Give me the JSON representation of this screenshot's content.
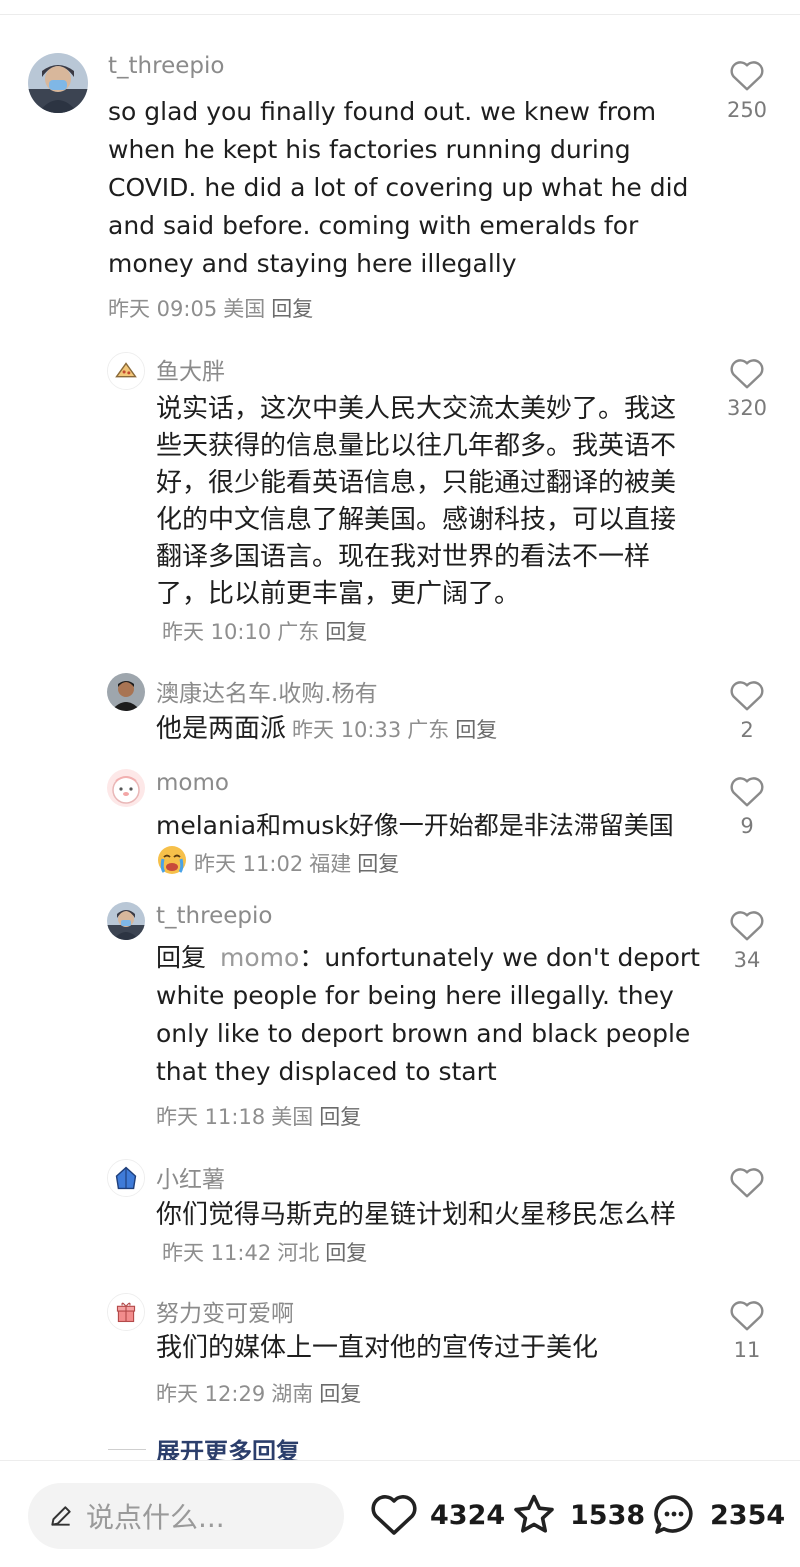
{
  "comments": [
    {
      "username": "t_threepio",
      "text": "so glad you finally found out. we knew from when he kept his factories running during COVID. he did a lot of covering up what he did and said before. coming with emeralds for money and staying here illegally",
      "time": "昨天 09:05",
      "location": "美国",
      "reply_label": "回复",
      "likes": "250"
    },
    {
      "username": "鱼大胖",
      "text": "说实话，这次中美人民大交流太美妙了。我这些天获得的信息量比以往几年都多。我英语不好，很少能看英语信息，只能通过翻译的被美化的中文信息了解美国。感谢科技，可以直接翻译多国语言。现在我对世界的看法不一样了，比以前更丰富，更广阔了。",
      "time": "昨天 10:10",
      "location": "广东",
      "reply_label": "回复",
      "likes": "320"
    },
    {
      "username": "澳康达名车.收购.杨有",
      "text": "他是两面派",
      "time": "昨天 10:33",
      "location": "广东",
      "reply_label": "回复",
      "likes": "2"
    },
    {
      "username": "momo",
      "text": "melania和musk好像一开始都是非法滞留美国",
      "time": "昨天 11:02",
      "location": "福建",
      "reply_label": "回复",
      "likes": "9"
    },
    {
      "username": "t_threepio",
      "reply_prefix": "回复",
      "reply_to": "momo",
      "reply_colon": "：",
      "text": "unfortunately we don't deport white people for being here illegally. they only like to deport brown and black people that they displaced to start",
      "time": "昨天 11:18",
      "location": "美国",
      "reply_label": "回复",
      "likes": "34"
    },
    {
      "username": "小红薯",
      "text": "你们觉得马斯克的星链计划和火星移民怎么样",
      "time": "昨天 11:42",
      "location": "河北",
      "reply_label": "回复",
      "likes": ""
    },
    {
      "username": "努力变可爱啊",
      "text": "我们的媒体上一直对他的宣传过于美化",
      "time": "昨天 12:29",
      "location": "湖南",
      "reply_label": "回复",
      "likes": "11"
    }
  ],
  "expand_label": "展开更多回复",
  "bottom_bar": {
    "input_placeholder": "说点什么...",
    "likes": "4324",
    "collects": "1538",
    "comments": "2354"
  },
  "icons": {
    "like": "heart-icon",
    "collect": "star-icon",
    "comment": "chat-bubble-icon",
    "input": "pencil-icon"
  }
}
